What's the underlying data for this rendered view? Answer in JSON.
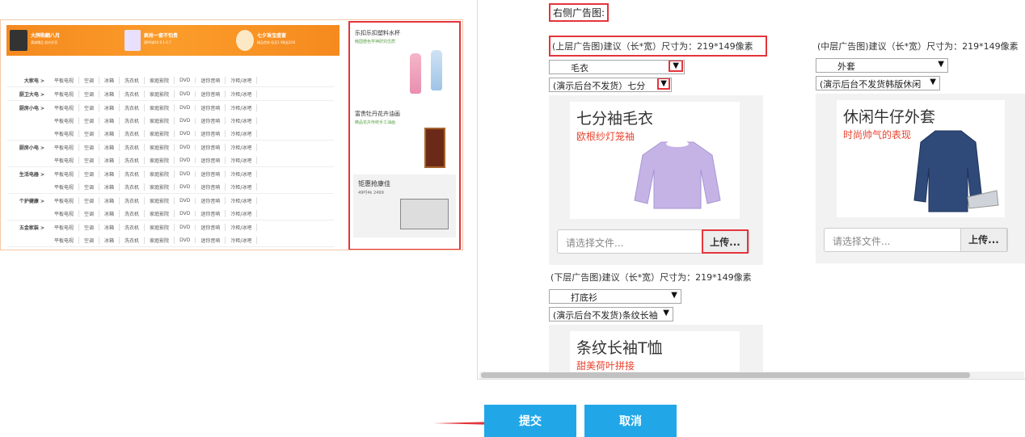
{
  "preview": {
    "banner": [
      {
        "title": "大牌购翻八月",
        "sub": "满减爆品 低价好货"
      },
      {
        "title": "疯抢一套不怕贵",
        "sub": "满99减50 6.1-6.7"
      },
      {
        "title": "七夕珠宝盛宴",
        "sub": "精品首饰 低至1.9折起100"
      }
    ],
    "category_items": [
      "平板电视",
      "空调",
      "冰箱",
      "洗衣机",
      "家庭影院",
      "DVD",
      "迷你音响",
      "冷柜/冰吧"
    ],
    "categories": [
      {
        "name": "大家电 >",
        "lines": 1
      },
      {
        "name": "厨卫大电 >",
        "lines": 1
      },
      {
        "name": "厨房小电 >",
        "lines": 3
      },
      {
        "name": "厨房小电 >",
        "lines": 2
      },
      {
        "name": "生活电器 >",
        "lines": 2
      },
      {
        "name": "个护健康 >",
        "lines": 2
      },
      {
        "name": "五金家装 >",
        "lines": 2
      }
    ],
    "side_ads": [
      {
        "title": "乐扣乐扣塑料水杯",
        "sub": "韩国橙色学神研究优质"
      },
      {
        "title": "富贵牡丹花卉油画",
        "sub": "精品花卉传统手工油画"
      },
      {
        "title": "钜惠抢康佳",
        "sub": "49吋4k 2499"
      }
    ]
  },
  "form": {
    "section_title": "右侧广告图:",
    "columns": [
      {
        "hint": "(上层广告图)建议（长*宽）尺寸为：219*149像素",
        "select1": "毛衣",
        "select2": "(演示后台不发货）七分",
        "pic_title": "七分袖毛衣",
        "pic_sub": "欧根纱灯笼袖",
        "upload_placeholder": "请选择文件...",
        "upload_button": "上传..."
      },
      {
        "hint": "(中层广告图)建议（长*宽）尺寸为：219*149像素",
        "select1": "外套",
        "select2": "(演示后台不发货韩版休闲",
        "pic_title": "休闲牛仔外套",
        "pic_sub": "时尚帅气的表现",
        "upload_placeholder": "请选择文件...",
        "upload_button": "上传..."
      },
      {
        "hint": "(下层广告图)建议（长*宽）尺寸为：219*149像素",
        "select1": "打底衫",
        "select2": "(演示后台不发货)条纹长袖",
        "pic_title": "条纹长袖T恤",
        "pic_sub": "甜美荷叶拼接"
      }
    ]
  },
  "actions": {
    "submit": "提交",
    "cancel": "取消"
  },
  "colors": {
    "accent_blue": "#21a7e8",
    "highlight_red": "#e4353c",
    "banner_orange": "#f58a1f"
  }
}
